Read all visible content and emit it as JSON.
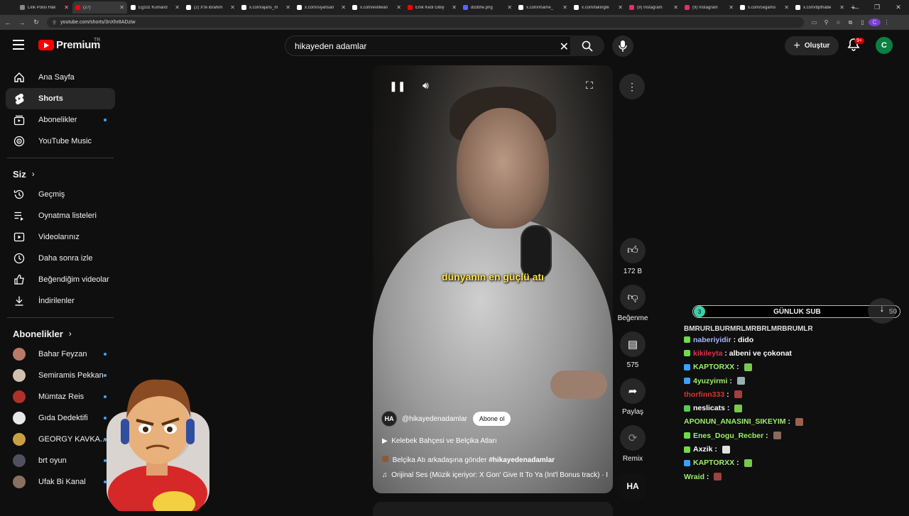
{
  "browser": {
    "tabs": [
      {
        "label": "Link Polisi Hak",
        "color": "#888888"
      },
      {
        "label": "(27) ",
        "color": "#ff0000",
        "active": true
      },
      {
        "label": "Egzoz Kumand",
        "color": "#ffffff"
      },
      {
        "label": "(2) X'te ibrahim",
        "color": "#ffffff"
      },
      {
        "label": "x.com/ajans_m",
        "color": "#ffffff"
      },
      {
        "label": "x.com/siyahsan",
        "color": "#ffffff"
      },
      {
        "label": "x.com/evillwan",
        "color": "#ffffff"
      },
      {
        "label": "Erlik Kedi Gibiy",
        "color": "#ff0000"
      },
      {
        "label": "dizibhe.png",
        "color": "#5566ff"
      },
      {
        "label": "x.com/marrie_",
        "color": "#ffffff"
      },
      {
        "label": "x.com/fakingte",
        "color": "#ffffff"
      },
      {
        "label": "(9) Instagram",
        "color": "#e1306c"
      },
      {
        "label": "(9) Instagram",
        "color": "#e1306c"
      },
      {
        "label": "x.com/cegamo",
        "color": "#ffffff"
      },
      {
        "label": "x.com/bpthabe",
        "color": "#ffffff"
      }
    ],
    "url": "youtube.com/shorts/3nXhr8ADziw",
    "profile_initial": "C"
  },
  "header": {
    "logo_text": "Premium",
    "country_code": "TR",
    "search_value": "hikayeden adamlar",
    "create_label": "Oluştur",
    "notif_badge": "9+",
    "avatar_initial": "C"
  },
  "sidebar": {
    "main": [
      {
        "label": "Ana Sayfa",
        "icon": "home-icon"
      },
      {
        "label": "Shorts",
        "icon": "shorts-icon",
        "active": true
      },
      {
        "label": "Abonelikler",
        "icon": "subscriptions-icon",
        "dot": true
      },
      {
        "label": "YouTube Music",
        "icon": "music-icon"
      }
    ],
    "you_heading": "Siz",
    "you": [
      {
        "label": "Geçmiş",
        "icon": "history-icon"
      },
      {
        "label": "Oynatma listeleri",
        "icon": "playlist-icon"
      },
      {
        "label": "Videolarınız",
        "icon": "your-videos-icon"
      },
      {
        "label": "Daha sonra izle",
        "icon": "watch-later-icon"
      },
      {
        "label": "Beğendiğim videolar",
        "icon": "liked-icon"
      },
      {
        "label": "İndirilenler",
        "icon": "download-icon"
      }
    ],
    "subs_heading": "Abonelikler",
    "subs": [
      {
        "label": "Bahar Feyzan",
        "color": "#b97a6a"
      },
      {
        "label": "Semiramis Pekkan",
        "color": "#d0c0b0"
      },
      {
        "label": "Mümtaz Reis",
        "color": "#b0302a"
      },
      {
        "label": "Gıda Dedektifi",
        "color": "#e8e8e8"
      },
      {
        "label": "GEORGY KAVKA...",
        "color": "#c8a040"
      },
      {
        "label": "brt oyun",
        "color": "#505060"
      },
      {
        "label": "Ufak Bi Kanal",
        "color": "#8a7060"
      }
    ]
  },
  "player": {
    "caption": "dünyanın en güçlü atı",
    "channel_logo": "HA",
    "channel": "@hikayedenadamlar",
    "subscribe_label": "Abone ol",
    "playlist_label": "Kelebek Bahçesi ve Belçika Atları",
    "title_prefix": "Belçika Atı arkadaşına gönder",
    "title_tag": "#hikayedenadamlar",
    "audio": "Orijinal Ses (Müzik içeriyor: X Gon' Give It To Ya (Int'l Bonus track) · I"
  },
  "actions": {
    "like_count": "172 B",
    "dislike_label": "Beğenme",
    "comment_count": "575",
    "share_label": "Paylaş",
    "remix_label": "Remix"
  },
  "overlay": {
    "sub_count": "3",
    "sub_title": "GÜNLUK SUB",
    "sub_goal": "50",
    "chat_partial": "BMRURLBURMRLMRBRLMRBRUMLR",
    "chat": [
      {
        "user": "naberiyidir",
        "msg": "dido",
        "user_color": "#a8b4ff",
        "badge_color": "#6fdc4a"
      },
      {
        "user": "kikileyta",
        "msg": "albeni ve çokonat",
        "user_color": "#e0304a",
        "badge_color": "#6fdc4a"
      },
      {
        "user": "KAPTORXX",
        "msg": "",
        "user_color": "#9cf06a",
        "badge_color": "#3aa0ff",
        "emo": "#78c850"
      },
      {
        "user": "4yuzyirmi",
        "msg": "",
        "user_color": "#9cf06a",
        "badge_color": "#3aa0ff",
        "emo": "#9ab0b0"
      },
      {
        "user": "thorfinn333",
        "msg": "",
        "user_color": "#e03030",
        "badge_color": "",
        "emo": "#a04040"
      },
      {
        "user": "neslicats",
        "msg": "",
        "user_color": "#ffffff",
        "badge_color": "#55cc55",
        "emo": "#78c850"
      },
      {
        "user": "APONUN_ANASINI_SIKEYIM",
        "msg": "",
        "user_color": "#9cf06a",
        "badge_color": "",
        "emo": "#a06050"
      },
      {
        "user": "Enes_Dogu_Recber",
        "msg": "",
        "user_color": "#9cf06a",
        "badge_color": "#6fdc4a",
        "emo": "#8a6a5a"
      },
      {
        "user": "Axzik",
        "msg": "",
        "user_color": "#ffffff",
        "badge_color": "#6fdc4a",
        "emo": "#e0e0e0"
      },
      {
        "user": "KAPTORXX",
        "msg": "",
        "user_color": "#9cf06a",
        "badge_color": "#3aa0ff",
        "emo": "#78c850"
      },
      {
        "user": "Wraid",
        "msg": "",
        "user_color": "#9cf06a",
        "badge_color": "",
        "emo": "#a04040"
      }
    ]
  }
}
